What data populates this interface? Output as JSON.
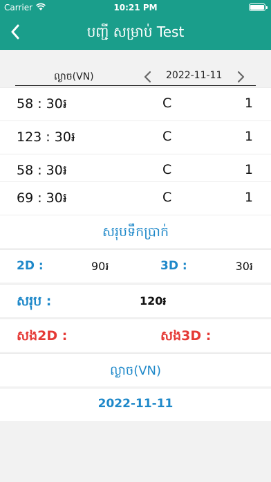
{
  "status_bar": {
    "carrier": "Carrier",
    "time": "10:21 PM"
  },
  "header": {
    "title": "បញ្ជី សម្រាប់ Test",
    "back_icon": "chevron-left-icon"
  },
  "list_header": {
    "lottery": "ល្ងាច(VN)",
    "date": "2022-11-11",
    "prev_icon": "chevron-left-icon",
    "next_icon": "chevron-right-icon"
  },
  "rows": [
    {
      "amount": "58 : 30៛",
      "type": "C",
      "count": "1"
    },
    {
      "amount": "123 : 30៛",
      "type": "C",
      "count": "1"
    },
    {
      "amount": "58 : 30៛",
      "type": "C",
      "count": "1"
    },
    {
      "amount": "69 : 30៛",
      "type": "C",
      "count": "1"
    }
  ],
  "summary": {
    "title": "សរុបទឹកប្រាក់",
    "label_2d": "2D :",
    "value_2d": "90៛",
    "label_3d": "3D :",
    "value_3d": "30៛",
    "total_label": "សរុប :",
    "total_value": "120៛",
    "loss_2d_label": "សង2D :",
    "loss_3d_label": "សង3D :"
  },
  "footer": {
    "lottery": "ល្ងាច(VN)",
    "date": "2022-11-11"
  },
  "colors": {
    "appbar": "#1a9e8b",
    "accent_blue": "#1e88c9",
    "accent_red": "#e53935"
  }
}
